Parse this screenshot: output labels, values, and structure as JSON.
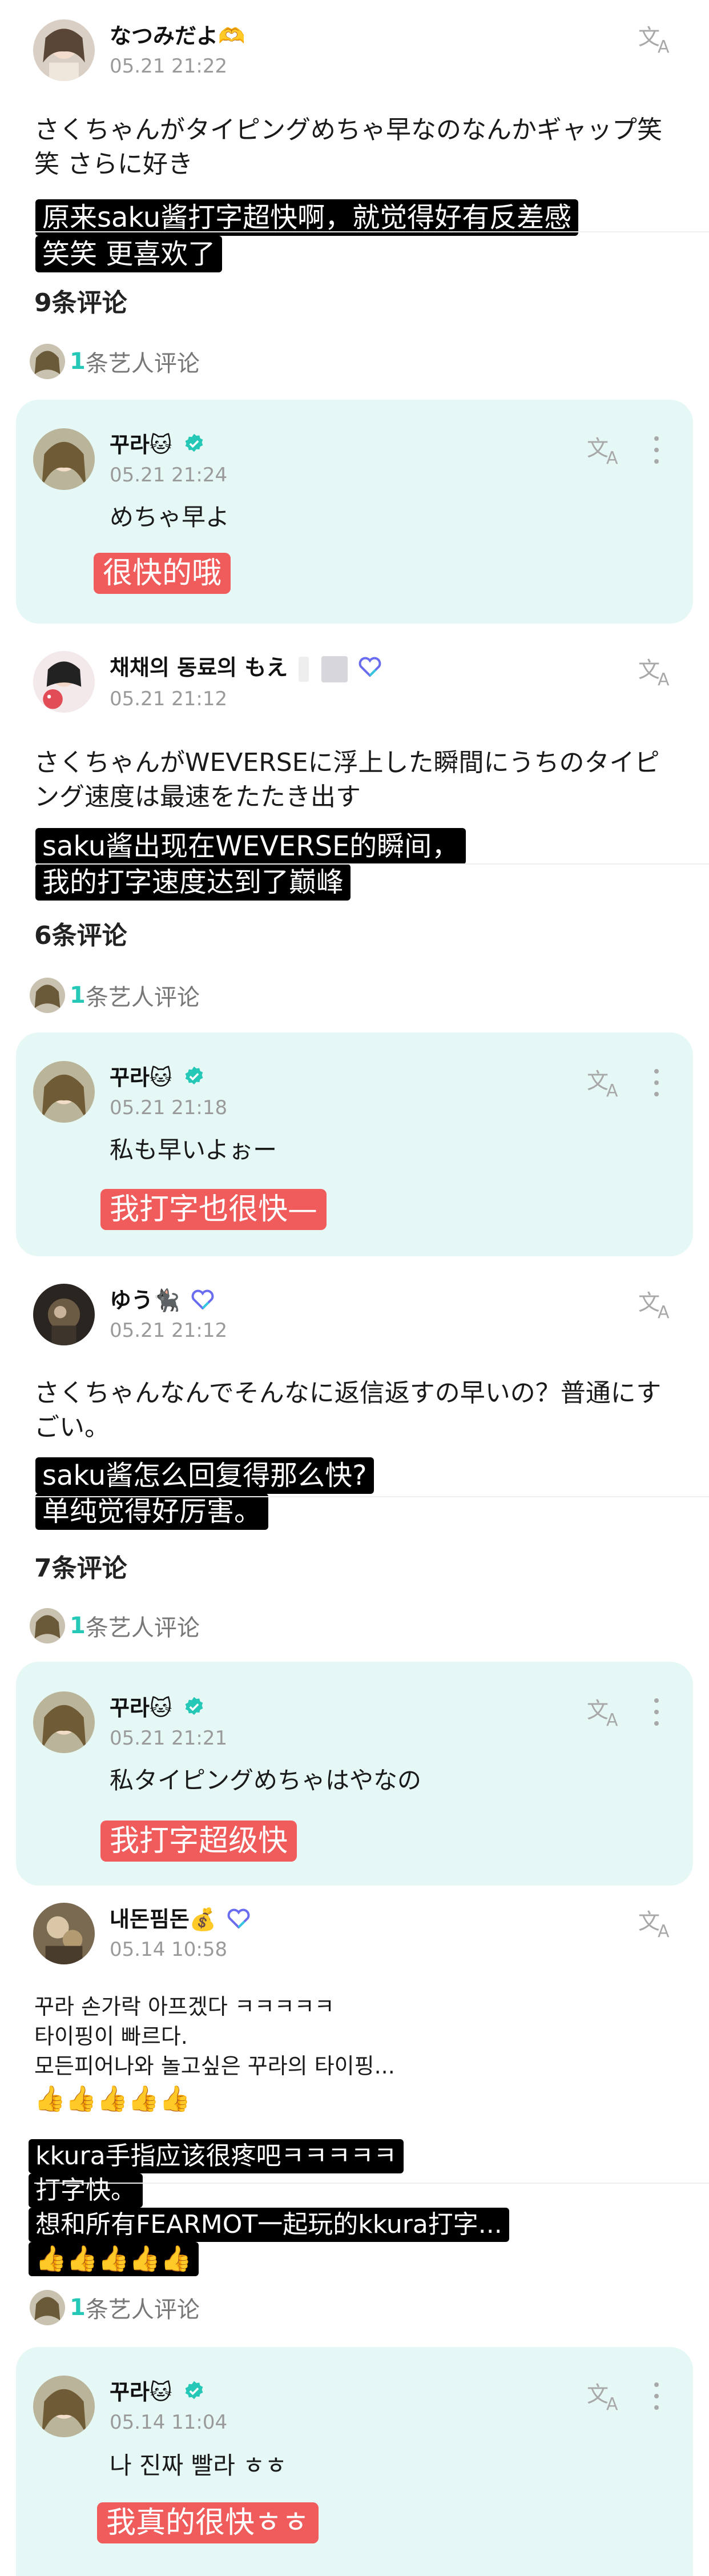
{
  "colors": {
    "accent": "#25c8b6",
    "reply_bg": "#e5f8f6",
    "highlight": "#000000",
    "pink_label": "#f05b5b",
    "muted": "#9a9a9a"
  },
  "icons": {
    "translate": "translate-icon",
    "more": "more-vert-icon",
    "verified": "verified-badge-icon",
    "hearts": "heart-icon"
  },
  "posts": [
    {
      "user": "なつみだよ🫶",
      "time": "05.21 21:22",
      "text": "さくちゃんがタイピングめちゃ早なのなんかギャップ笑笑 さらに好き",
      "translation": [
        "原来saku酱打字超快啊，就觉得好有反差感",
        "笑笑 更喜欢了"
      ],
      "comment_count": "9条评论",
      "artist_count": "1",
      "artist_label": "条艺人评论",
      "reply": {
        "user": "꾸라🐱",
        "time": "05.21 21:24",
        "text": "めちゃ早よ",
        "translation": "很快的哦"
      }
    },
    {
      "user": "채채의 동료의 もえ",
      "time": "05.21 21:12",
      "text": "さくちゃんがWEVERSEに浮上した瞬間にうちのタイピング速度は最速をたたき出す",
      "translation": [
        "saku酱出现在WEVERSE的瞬间，",
        "我的打字速度达到了巅峰"
      ],
      "comment_count": "6条评论",
      "artist_count": "1",
      "artist_label": "条艺人评论",
      "reply": {
        "user": "꾸라🐱",
        "time": "05.21 21:18",
        "text": "私も早いよぉー",
        "translation": "我打字也很快—"
      }
    },
    {
      "user": "ゆう🐈‍⬛",
      "time": "05.21 21:12",
      "text": "さくちゃんなんでそんなに返信返すの早いの？普通にすごい。",
      "translation": [
        "saku酱怎么回复得那么快?",
        "单纯觉得好厉害。"
      ],
      "comment_count": "7条评论",
      "artist_count": "1",
      "artist_label": "条艺人评论",
      "reply": {
        "user": "꾸라🐱",
        "time": "05.21 21:21",
        "text": "私タイピングめちゃはやなの",
        "translation": "我打字超级快"
      }
    },
    {
      "user": "내돈핌돈💰",
      "time": "05.14 10:58",
      "text_lines": [
        "꾸라 손가락 아프겠다 ㅋㅋㅋㅋㅋ",
        "타이핑이 빠르다.",
        "모든피어나와 놀고싶은 꾸라의 타이핑...",
        "👍👍👍👍👍"
      ],
      "translation": [
        "kkura手指应该很疼吧ㅋㅋㅋㅋㅋ",
        "打字快。",
        "想和所有FEARMOT一起玩的kkura打字...",
        "👍👍👍👍👍"
      ],
      "artist_count": "1",
      "artist_label": "条艺人评论",
      "reply": {
        "user": "꾸라🐱",
        "time": "05.14 11:04",
        "text": "나 진짜 빨라 ㅎㅎ",
        "translation": "我真的很快ㅎㅎ"
      }
    }
  ]
}
